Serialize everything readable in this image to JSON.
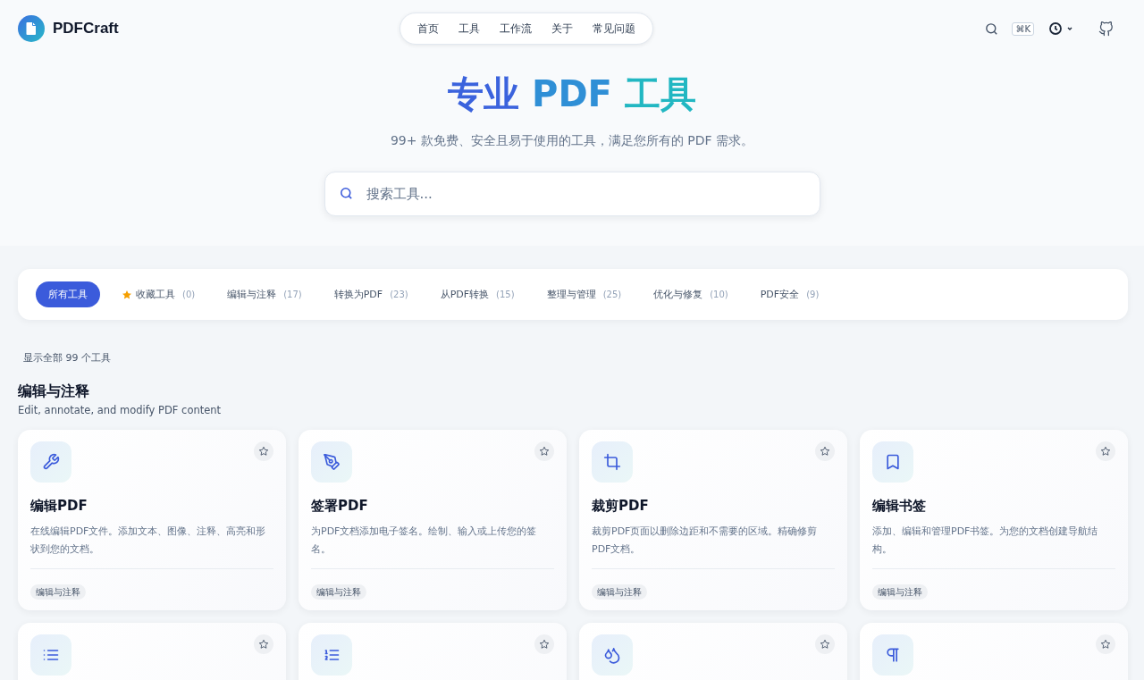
{
  "brand": {
    "name": "PDFCraft"
  },
  "nav": [
    {
      "label": "首页"
    },
    {
      "label": "工具"
    },
    {
      "label": "工作流"
    },
    {
      "label": "关于"
    },
    {
      "label": "常见问题"
    }
  ],
  "shortcut": "⌘K",
  "hero": {
    "title": [
      {
        "text": "专业 ",
        "kind": "blue"
      },
      {
        "text": "PDF ",
        "kind": "mid"
      },
      {
        "text": "工具",
        "kind": "teal"
      }
    ],
    "subtitle": "99+ 款免费、安全且易于使用的工具，满足您所有的 PDF 需求。",
    "search": {
      "placeholder": "搜索工具..."
    }
  },
  "tabs": [
    {
      "label": "所有工具",
      "kind": "plain",
      "selected": true
    },
    {
      "label": "收藏工具",
      "count": "(0)",
      "kind": "favorites",
      "selected": false
    },
    {
      "label": "编辑与注释",
      "count": "(17)",
      "kind": "plain",
      "selected": false
    },
    {
      "label": "转换为PDF",
      "count": "(23)",
      "kind": "plain",
      "selected": false
    },
    {
      "label": "从PDF转换",
      "count": "(15)",
      "kind": "plain",
      "selected": false
    },
    {
      "label": "整理与管理",
      "count": "(25)",
      "kind": "plain",
      "selected": false
    },
    {
      "label": "优化与修复",
      "count": "(10)",
      "kind": "plain",
      "selected": false
    },
    {
      "label": "PDF安全",
      "count": "(9)",
      "kind": "plain",
      "selected": false
    }
  ],
  "result_count": "显示全部 99 个工具",
  "section": {
    "title": "编辑与注释",
    "subtitle": "Edit, annotate, and modify PDF content",
    "tools": [
      {
        "kind": "wrench",
        "title": "编辑PDF",
        "description": "在线编辑PDF文件。添加文本、图像、注释、高亮和形状到您的文档。",
        "tag": "编辑与注释",
        "favorited": false
      },
      {
        "kind": "pen",
        "title": "签署PDF",
        "description": "为PDF文档添加电子签名。绘制、输入或上传您的签名。",
        "tag": "编辑与注释",
        "favorited": false
      },
      {
        "kind": "crop",
        "title": "裁剪PDF",
        "description": "裁剪PDF页面以删除边距和不需要的区域。精确修剪PDF文档。",
        "tag": "编辑与注释",
        "favorited": false
      },
      {
        "kind": "bookmark",
        "title": "编辑书签",
        "description": "添加、编辑和管理PDF书签。为您的文档创建导航结构。",
        "tag": "编辑与注释",
        "favorited": false
      },
      {
        "kind": "list",
        "favorited": false
      },
      {
        "kind": "numbered-list",
        "favorited": false
      },
      {
        "kind": "drops",
        "favorited": false
      },
      {
        "kind": "pilcrow",
        "favorited": false
      }
    ]
  }
}
